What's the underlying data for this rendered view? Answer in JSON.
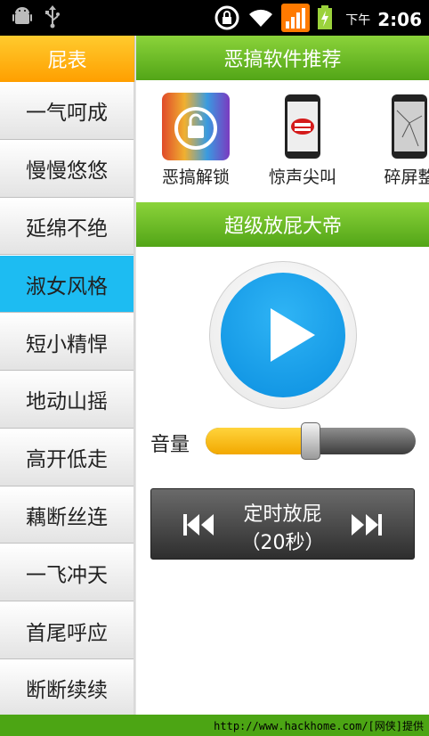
{
  "status_bar": {
    "time_prefix": "下午",
    "time": "2:06",
    "icons": [
      "android-debug-icon",
      "usb-icon",
      "screen-rotation-lock-icon",
      "wifi-icon",
      "signal-icon",
      "battery-charging-icon"
    ]
  },
  "sidebar": {
    "title": "屁表",
    "active_index": 3,
    "items": [
      {
        "label": "一气呵成"
      },
      {
        "label": "慢慢悠悠"
      },
      {
        "label": "延绵不绝"
      },
      {
        "label": "淑女风格"
      },
      {
        "label": "短小精悍"
      },
      {
        "label": "地动山摇"
      },
      {
        "label": "高开低走"
      },
      {
        "label": "藕断丝连"
      },
      {
        "label": "一飞冲天"
      },
      {
        "label": "首尾呼应"
      },
      {
        "label": "断断续续"
      }
    ]
  },
  "recommend": {
    "title": "恶搞软件推荐",
    "apps": [
      {
        "label": "恶搞解锁",
        "icon": "unlock-icon"
      },
      {
        "label": "惊声尖叫",
        "icon": "scream-phone-icon"
      },
      {
        "label": "碎屏整",
        "icon": "cracked-screen-phone-icon"
      }
    ]
  },
  "player": {
    "title": "超级放屁大帝",
    "volume_label": "音量",
    "volume_fraction": 0.5,
    "timer_title": "定时放屁",
    "timer_value": "（20秒）"
  },
  "footer": {
    "text": "http://www.hackhome.com/[网侠]提供"
  },
  "colors": {
    "green": "#6fbf2a",
    "orange": "#ffb000",
    "active_blue": "#1dbcf2",
    "play_blue": "#1aa0eb"
  }
}
